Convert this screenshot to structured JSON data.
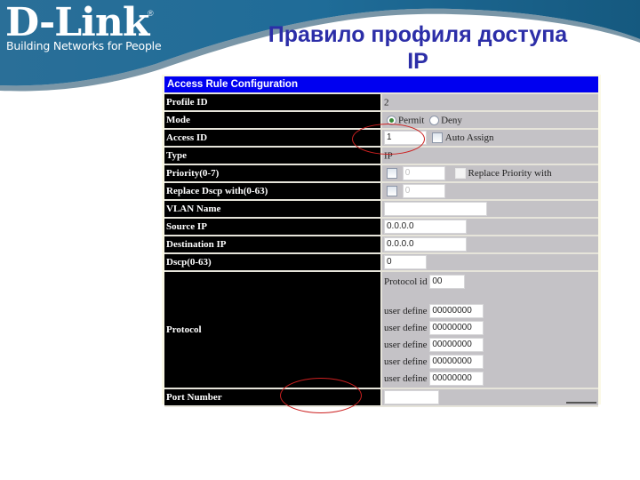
{
  "slide": {
    "title_line1": "Правило профиля доступа",
    "title_line2": "IP"
  },
  "brand": {
    "logo_text": "D-Link",
    "registered_mark": "®",
    "tagline": "Building Networks for People",
    "banner_color": "#1d6a96"
  },
  "form": {
    "header": "Access Rule Configuration",
    "header_color": "#0000f0",
    "rows": {
      "profile_id": {
        "label": "Profile ID",
        "value": "2"
      },
      "mode": {
        "label": "Mode",
        "options": [
          "Permit",
          "Deny"
        ],
        "selected": "Permit"
      },
      "access_id": {
        "label": "Access ID",
        "value": "1",
        "auto_assign_label": "Auto Assign",
        "auto_assign_checked": false
      },
      "type": {
        "label": "Type",
        "value": "IP"
      },
      "priority": {
        "label": "Priority(0-7)",
        "value": "0",
        "replace_label": "Replace Priority with"
      },
      "replace_dscp": {
        "label": "Replace Dscp with(0-63)",
        "value": "0"
      },
      "vlan_name": {
        "label": "VLAN Name",
        "value": ""
      },
      "source_ip": {
        "label": "Source IP",
        "value": "0.0.0.0"
      },
      "destination_ip": {
        "label": "Destination IP",
        "value": "0.0.0.0"
      },
      "dscp": {
        "label": "Dscp(0-63)",
        "value": "0"
      },
      "protocol": {
        "label": "Protocol",
        "protocol_id_label": "Protocol id",
        "protocol_id_value": "00",
        "user_define_label": "user define",
        "user_defines": [
          "00000000",
          "00000000",
          "00000000",
          "00000000",
          "00000000"
        ]
      },
      "port_number": {
        "label": "Port Number",
        "value": ""
      }
    }
  },
  "annotations": {
    "highlight_color": "#cc2020",
    "highlighted": [
      "auto-assign",
      "port-number"
    ]
  }
}
